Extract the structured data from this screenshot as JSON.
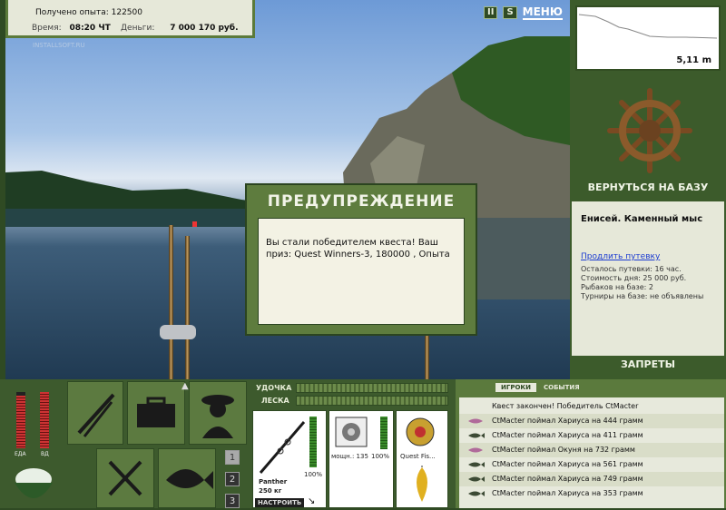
{
  "hud": {
    "experience_label": "Получено опыта:",
    "experience_value": "122500",
    "time_label": "Время:",
    "time_value": "08:20 ЧТ",
    "money_label": "Деньги:",
    "money_value": "7 000 170 руб.",
    "watermark": "INSTALLSOFT.RU"
  },
  "controls": {
    "pause": "II",
    "sound": "S",
    "menu": "МЕНЮ"
  },
  "depth": {
    "value": "5,11 m"
  },
  "right_panel": {
    "return_button": "ВЕРНУТЬСЯ НА БАЗУ",
    "location_name": "Енисей. Каменный мыс",
    "extend_voucher": "Продлить путевку",
    "lines": [
      "Осталось путевки: 16 час.",
      "Стоимость дня: 25 000 руб.",
      "Рыбаков на базе: 2",
      "Турниры на базе: не объявлены"
    ],
    "bans_button": "ЗАПРЕТЫ"
  },
  "dialog": {
    "title": "ПРЕДУПРЕЖДЕНИЕ",
    "message": "Вы стали победителем квеста! Ваш приз: Quest Winners-3, 180000 , Опыта"
  },
  "status_bars": {
    "food_label": "ЕДА",
    "water_label": "ВД"
  },
  "page_numbers": [
    "1",
    "2",
    "3"
  ],
  "tackle": {
    "rod_label": "УДОЧКА",
    "line_label": "ЛЕСКА",
    "rod_name": "Panther",
    "rod_weight": "250 кг",
    "rod_percent": "100%",
    "reel_power": "мощн.: 135",
    "reel_percent": "100%",
    "line_name": "Quest Fis...",
    "tune_button": "НАСТРОИТЬ"
  },
  "events": {
    "tab_players": "ИГРОКИ",
    "tab_events": "СОБЫТИЯ",
    "items": [
      {
        "text": "Квест закончен! Победитель CtMacter",
        "icon": "none"
      },
      {
        "text": "CtMacter поймал Хариуса на 444 грамм",
        "icon": "hook-icon"
      },
      {
        "text": "CtMacter поймал Хариуса на 411 грамм",
        "icon": "fish-icon"
      },
      {
        "text": "CtMacter поймал Окуня на 732 грамм",
        "icon": "hook-icon"
      },
      {
        "text": "CtMacter поймал Хариуса на 561 грамм",
        "icon": "fish-icon"
      },
      {
        "text": "CtMacter поймал Хариуса на 749 грамм",
        "icon": "fish-icon"
      },
      {
        "text": "CtMacter поймал Хариуса на 353 грамм",
        "icon": "fish-icon"
      }
    ]
  }
}
